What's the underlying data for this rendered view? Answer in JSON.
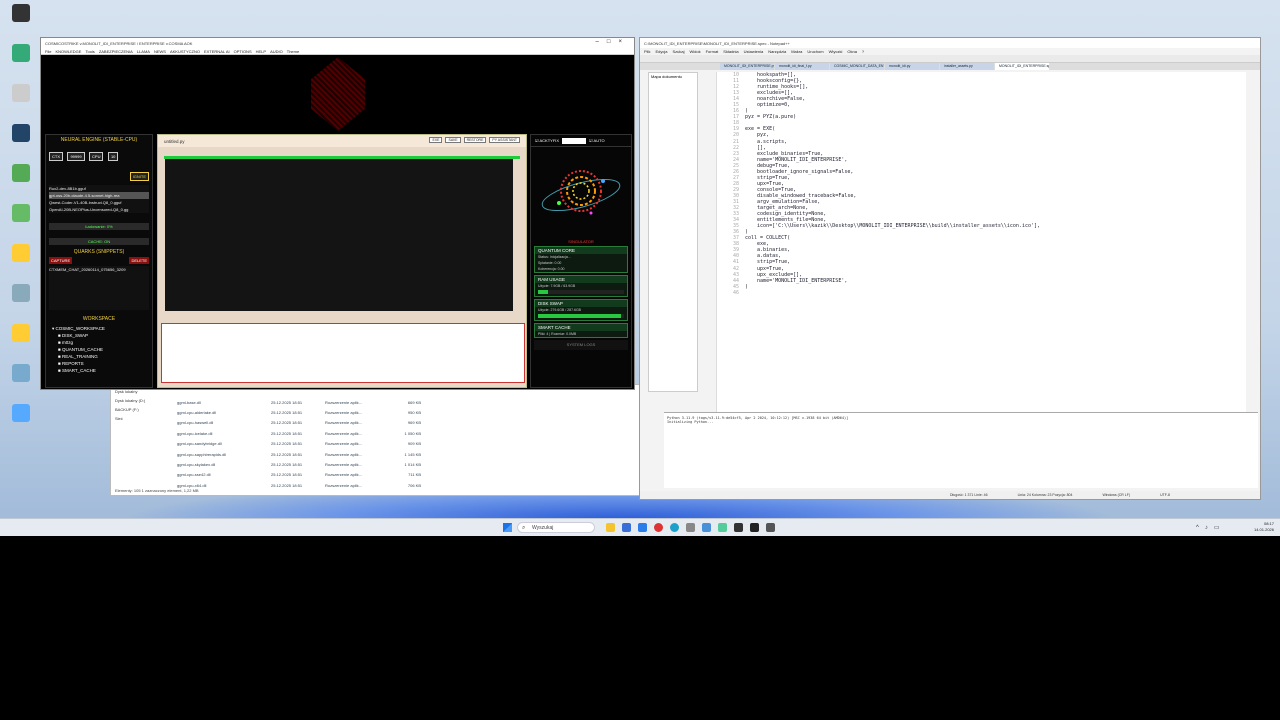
{
  "desktop_icons": [
    "",
    "",
    "",
    "",
    "",
    "",
    "",
    "",
    "",
    "",
    "",
    "",
    "",
    "",
    ""
  ],
  "ide": {
    "title": "COSMICOSTRIKE v.MONOLIT_IDI_ENTERPRISE / ENTERPRISE v.COSMA AOK",
    "menu": [
      "File",
      "KNOWLEDGE",
      "Tools",
      "ZABEZPIECZENIA",
      "LLAMA",
      "NEWS",
      "AKKUSTYCZNO",
      "EXTERNAL AI",
      "OPTIONS",
      "HELP",
      "AUDIO",
      "Theme"
    ],
    "left": {
      "title": "NEURAL ENGINE (STABLE-CPU)",
      "ctx_label": "CTX",
      "ctx_value": "99999",
      "cpu_label": "CPU",
      "cpu_value": "10",
      "ignite": "IGNITE",
      "models": [
        "Rux2-dev-8B1b.gguf",
        "gpt-oss-20b-claude-4.5-sonnet-high-rea",
        "Qwest-Coder-V1-40B-Instruct.Q8_0.gguf",
        "OpenAI-20B-NEOPlus-Uncensored-Q8_0.gg"
      ],
      "loading": "Ładowanie: 0%",
      "cache": "CACHE: ON",
      "quarks_title": "QUARKS (SNIPPETS)",
      "capture": "CAPTURE",
      "delete": "DELETE",
      "snippet": "CTXMEM_CHAT_20260114_075656_3209",
      "workspace_title": "WORKSPACE",
      "tree": [
        "COSMIC_WORKSPACE",
        "DISK_SWAP",
        "m0zg",
        "QUANTUM_CACHE",
        "REAL_TRAINING",
        "REPORTS",
        "SMART_CACHE"
      ]
    },
    "center": {
      "filename": "untitled.py",
      "buttons": [
        "EXE",
        "SAVE",
        "RESTORE",
        "PY ASSISTANT"
      ]
    },
    "right": {
      "actions": "ACKTYFIX",
      "auto": "AUTO",
      "caption": "SINGULATOR",
      "quantum_title": "QUANTUM CORE",
      "quantum_lines": [
        "Status: Inicjalizacja...",
        "Splatanie: 0.00",
        "Koherencja: 0.00"
      ],
      "ram_title": "RAM USAGE",
      "ram_line": "Użycie: 7.9GB / 63.9GB",
      "ram_fill": 0.12,
      "disk_title": "DISK SWAP",
      "disk_line": "Użycie: 279.6GB / 287.6GB",
      "disk_fill": 0.97,
      "smart_title": "SMART CACHE",
      "smart_line": "Pliki: 4 | Rozmiar: 0.0MB",
      "logs": "SYSTEM LOGS"
    }
  },
  "explorer": {
    "tree": [
      "Dysk lokalny",
      "Dysk lokalny (D:)",
      "BACKUP (F:)",
      "Sieć"
    ],
    "files": [
      {
        "name": "ggml-base.dll",
        "date": "25.12.2025 18:51",
        "type": "Rozszerzenie aplik...",
        "size": "669 KB"
      },
      {
        "name": "ggml-cpu-alderlake.dll",
        "date": "25.12.2025 18:51",
        "type": "Rozszerzenie aplik...",
        "size": "950 KB"
      },
      {
        "name": "ggml-cpu-haswell.dll",
        "date": "25.12.2025 18:51",
        "type": "Rozszerzenie aplik...",
        "size": "969 KB"
      },
      {
        "name": "ggml-cpu-icelake.dll",
        "date": "25.12.2025 18:51",
        "type": "Rozszerzenie aplik...",
        "size": "1 050 KB"
      },
      {
        "name": "ggml-cpu-sandybridge.dll",
        "date": "25.12.2025 18:51",
        "type": "Rozszerzenie aplik...",
        "size": "909 KB"
      },
      {
        "name": "ggml-cpu-sapphirerapids.dll",
        "date": "25.12.2025 18:51",
        "type": "Rozszerzenie aplik...",
        "size": "1 145 KB"
      },
      {
        "name": "ggml-cpu-skylakex.dll",
        "date": "25.12.2025 18:51",
        "type": "Rozszerzenie aplik...",
        "size": "1 014 KB"
      },
      {
        "name": "ggml-cpu-sse42.dll",
        "date": "25.12.2025 18:51",
        "type": "Rozszerzenie aplik...",
        "size": "711 KB"
      },
      {
        "name": "ggml-cpu-x64.dll",
        "date": "25.12.2025 18:51",
        "type": "Rozszerzenie aplik...",
        "size": "706 KB"
      }
    ],
    "status": "Elementy: 105   1 zaznaczony element, 1,22 MB"
  },
  "editor": {
    "title": "C:\\MONOLIT_IDI_ENTERPRISE\\MONOLIT_IDI_ENTERPRISE.spec - Notepad++",
    "menu": [
      "Plik",
      "Edycja",
      "Szukaj",
      "Widok",
      "Format",
      "Składnia",
      "Ustawienia",
      "Narzędzia",
      "Makra",
      "Uruchom",
      "Wtyczki",
      "Okna",
      "?"
    ],
    "tabs": [
      "MONOLIT_IDI_ENTERPRISE.py",
      "monolit_idi_final_f.py",
      "COSMIC_MONOLIT_DATA_ENTERPRISE.py",
      "monolit_idi.py",
      "installer_assets.py",
      "MONOLIT_IDI_ENTERPRISE.spec"
    ],
    "side": "Mapa dokumentu",
    "code": [
      {
        "n": "10",
        "t": "    hookspath=[],"
      },
      {
        "n": "11",
        "t": "    hooksconfig={},"
      },
      {
        "n": "12",
        "t": "    runtime_hooks=[],"
      },
      {
        "n": "13",
        "t": "    excludes=[],"
      },
      {
        "n": "14",
        "t": "    noarchive=False,"
      },
      {
        "n": "15",
        "t": "    optimize=0,"
      },
      {
        "n": "16",
        "t": ")"
      },
      {
        "n": "17",
        "t": "pyz = PYZ(a.pure)"
      },
      {
        "n": "18",
        "t": ""
      },
      {
        "n": "19",
        "t": "exe = EXE("
      },
      {
        "n": "20",
        "t": "    pyz,"
      },
      {
        "n": "21",
        "t": "    a.scripts,"
      },
      {
        "n": "22",
        "t": "    [],"
      },
      {
        "n": "23",
        "t": "    exclude_binaries=True,"
      },
      {
        "n": "24",
        "t": "    name='MONOLIT_IDI_ENTERPRISE',"
      },
      {
        "n": "25",
        "t": "    debug=True,"
      },
      {
        "n": "26",
        "t": "    bootloader_ignore_signals=False,"
      },
      {
        "n": "27",
        "t": "    strip=True,"
      },
      {
        "n": "28",
        "t": "    upx=True,"
      },
      {
        "n": "29",
        "t": "    console=True,"
      },
      {
        "n": "30",
        "t": "    disable_windowed_traceback=False,"
      },
      {
        "n": "31",
        "t": "    argv_emulation=False,"
      },
      {
        "n": "32",
        "t": "    target_arch=None,"
      },
      {
        "n": "33",
        "t": "    codesign_identity=None,"
      },
      {
        "n": "34",
        "t": "    entitlements_file=None,"
      },
      {
        "n": "35",
        "t": "    icon=['C:\\\\Users\\\\kazik\\\\Desktop\\\\MONOLIT_IDI_ENTERPRISE\\\\build\\\\installer_assets\\\\icon.ico'],"
      },
      {
        "n": "36",
        "t": ")"
      },
      {
        "n": "37",
        "t": "coll = COLLECT("
      },
      {
        "n": "38",
        "t": "    exe,"
      },
      {
        "n": "39",
        "t": "    a.binaries,"
      },
      {
        "n": "40",
        "t": "    a.datas,"
      },
      {
        "n": "41",
        "t": "    strip=True,"
      },
      {
        "n": "42",
        "t": "    upx=True,"
      },
      {
        "n": "43",
        "t": "    upx_exclude=[],"
      },
      {
        "n": "44",
        "t": "    name='MONOLIT_IDI_ENTERPRISE',"
      },
      {
        "n": "45",
        "t": ")"
      },
      {
        "n": "46",
        "t": ""
      }
    ],
    "console_lines": [
      "Python 3.11.9 (tags/v3.11.9:de54cf5, Apr 2 2024, 10:12:12) [MSC v.1938 64 bit (AMD64)]",
      "Initializing Python..."
    ],
    "status": [
      "Długość: 1 371   Linie: 46",
      "Linia: 24   Kolumna: 23   Pozycja: 804",
      "Windows (CR LF)",
      "UTF-8"
    ]
  },
  "taskbar": {
    "search": "Wyszukaj",
    "time": "08:17",
    "date": "14.01.2026"
  }
}
